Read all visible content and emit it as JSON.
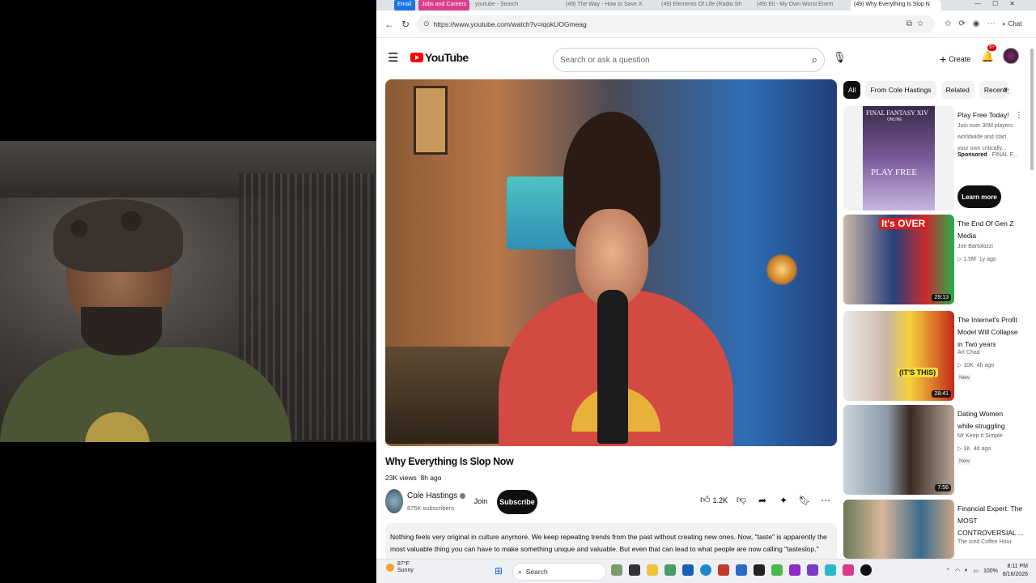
{
  "browser": {
    "tabs": [
      {
        "label": "Email",
        "kind": "pill",
        "color": "#1a73e8"
      },
      {
        "label": "Jobs and Careers",
        "kind": "pill",
        "color": "#d93f8c"
      },
      {
        "label": "youtube - Search",
        "kind": "normal"
      },
      {
        "label": "(49) The Way - How to Save X",
        "kind": "normal"
      },
      {
        "label": "(49) Elements Of Life (Radio Sh",
        "kind": "normal"
      },
      {
        "label": "(49) Eli - My Own Worst Enem",
        "kind": "normal"
      },
      {
        "label": "(49) Why Everything Is Slop N",
        "kind": "active"
      }
    ],
    "url": "https://www.youtube.com/watch?v=iqokUOGmeag",
    "chat_label": "Chat"
  },
  "header": {
    "logo_text": "YouTube",
    "search_placeholder": "Search or ask a question",
    "create_label": "Create",
    "notification_count": "9+"
  },
  "video": {
    "title": "Why Everything Is Slop Now",
    "views": "23K views",
    "age": "8h ago",
    "channel": "Cole Hastings",
    "subscribers": "875K subscribers",
    "join_label": "Join",
    "subscribe_label": "Subscribe",
    "likes": "1.2K",
    "description": "Nothing feels very original in culture anymore. We keep repeating trends from the past without creating new ones. Now, \"taste\" is apparently the most valuable thing you can have to make something unique and valuable. But even that can lead to what people are now calling \"tasteslop.\" Let's talk about why."
  },
  "chips": [
    "All",
    "From Cole Hastings",
    "Related",
    "Recently u"
  ],
  "ad": {
    "title": "Play Free Today!",
    "subtitle": "Join over 30M players worldwide and start your own critically...",
    "sponsored_label": "Sponsored",
    "advertiser": "FINAL F...",
    "cta": "Learn more",
    "thumb_title": "FINAL FANTASY XIV",
    "thumb_sub": "ONLINE",
    "thumb_play": "PLAY FREE"
  },
  "recommendations": [
    {
      "title": "The End Of Gen Z Media",
      "channel": "Joe Bartolozzi",
      "views": "1.5M",
      "age": "1y ago",
      "duration": "29:13",
      "new": "",
      "thumb_text": "It's OVER"
    },
    {
      "title": "The Internet's Profit Model Will Collapse in Two years",
      "channel": "Art Chad",
      "views": "10K",
      "age": "4h ago",
      "duration": "28:41",
      "new": "New",
      "thumb_text": "(IT'S THIS)"
    },
    {
      "title": "Dating Women while struggling",
      "channel": "Mr Keep It Simple",
      "views": "1K",
      "age": "4d ago",
      "duration": "7:56",
      "new": "New",
      "thumb_text": ""
    },
    {
      "title": "Financial Expert: The MOST CONTROVERSIAL ...",
      "channel": "The Iced Coffee Hour",
      "views": "",
      "age": "",
      "duration": "",
      "new": "",
      "thumb_text": ""
    }
  ],
  "taskbar": {
    "temperature": "87°F",
    "weather": "Sunny",
    "search_label": "Search",
    "battery": "100%",
    "time": "8:11 PM",
    "date": "8/16/2026"
  }
}
